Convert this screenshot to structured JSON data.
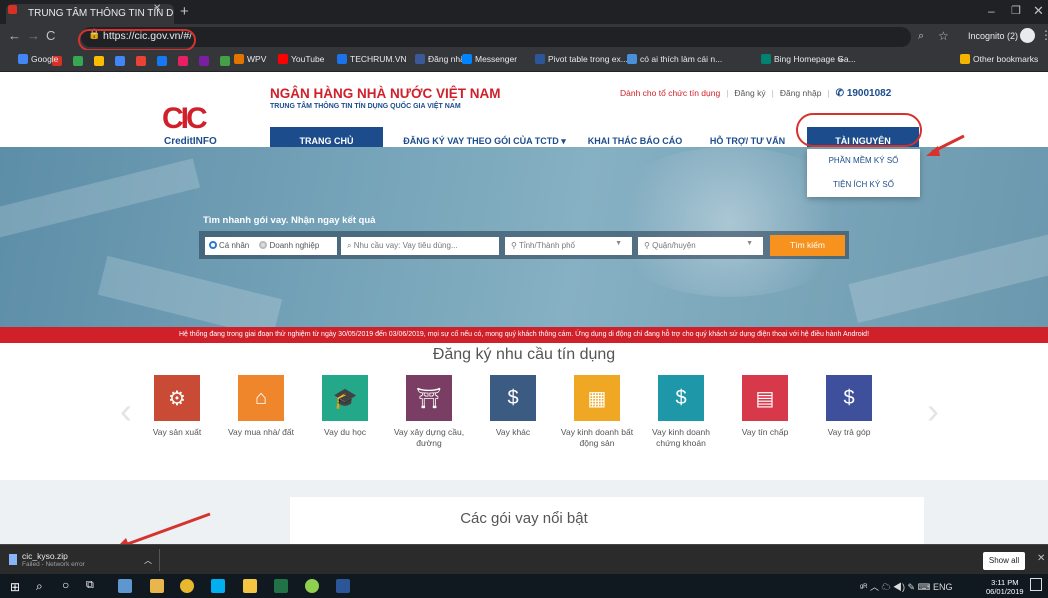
{
  "browser": {
    "tab_title": "TRUNG TÂM THÔNG TIN TÍN DỤ",
    "url": "https://cic.gov.vn/#/",
    "incognito_label": "Incognito (2)",
    "bookmarks": [
      {
        "label": "Google",
        "color": "#4285f4"
      },
      {
        "label": "WPV",
        "color": "#e37400"
      },
      {
        "label": "YouTube",
        "color": "#ff0000"
      },
      {
        "label": "TECHRUM.VN",
        "color": "#1a73e8"
      },
      {
        "label": "Đăng nhập",
        "color": "#3b5998"
      },
      {
        "label": "Messenger",
        "color": "#0084ff"
      },
      {
        "label": "Pivot table trong ex...",
        "color": "#2b579a"
      },
      {
        "label": "có ai thích làm cái n...",
        "color": "#4a90d9"
      },
      {
        "label": "Bing Homepage Ga...",
        "color": "#008373"
      }
    ],
    "other_bookmarks": "Other bookmarks"
  },
  "site": {
    "logo_text_1": "CIC",
    "logo_text_2": "CreditINFO",
    "title": "NGÂN HÀNG NHÀ NƯỚC VIỆT NAM",
    "subtitle": "TRUNG TÂM THÔNG TIN TÍN DỤNG QUỐC GIA VIỆT NAM",
    "top_links": {
      "org": "Dành cho tổ chức tín dụng",
      "register": "Đăng ký",
      "login": "Đăng nhập",
      "hotline": "19001082"
    },
    "nav": [
      "TRANG CHỦ",
      "ĐĂNG KÝ VAY THEO GÓI CỦA TCTD ▾",
      "KHAI THÁC BÁO CÁO",
      "HỖ TRỢ/ TƯ VẤN",
      "TÀI NGUYÊN"
    ],
    "dropdown": [
      "PHẦN MỀM KÝ SỐ",
      "TIỆN ÍCH KÝ SỐ"
    ],
    "search": {
      "title": "Tìm nhanh gói vay. Nhận ngay kết quả",
      "radio_individual": "Cá nhân",
      "radio_business": "Doanh nghiệp",
      "need_placeholder": "Nhu cầu vay: Vay tiêu dùng...",
      "province": "Tỉnh/Thành phố",
      "district": "Quận/huyện",
      "button": "Tìm kiếm"
    },
    "notice": "Hệ thống đang trong giai đoạn thử nghiệm từ ngày 30/05/2019 đến 03/06/2019, mọi sự cố nếu có, mong quý khách thông cảm. Ứng dụng di động chỉ đang hỗ trợ cho quý khách sử dụng điện thoại với hệ điều hành Android!",
    "services_title": "Đăng ký nhu cầu tín dụng",
    "services": [
      {
        "label": "Vay sản xuất",
        "color": "#c94a35",
        "icon": "⚙"
      },
      {
        "label": "Vay mua nhà/ đất",
        "color": "#f0862c",
        "icon": "⌂"
      },
      {
        "label": "Vay du học",
        "color": "#24a88a",
        "icon": "🎓"
      },
      {
        "label": "Vay xây dựng cầu, đường",
        "color": "#7a3d63",
        "icon": "⛩"
      },
      {
        "label": "Vay khác",
        "color": "#3c5b82",
        "icon": "$"
      },
      {
        "label": "Vay kinh doanh bất động sản",
        "color": "#f0a824",
        "icon": "▦"
      },
      {
        "label": "Vay kinh doanh chứng khoán",
        "color": "#1e98a8",
        "icon": "$"
      },
      {
        "label": "Vay tín chấp",
        "color": "#d8394a",
        "icon": "▤"
      },
      {
        "label": "Vay trả góp",
        "color": "#3e4f9c",
        "icon": "$"
      }
    ],
    "packages_title": "Các gói vay nổi bật"
  },
  "download": {
    "filename": "cic_kyso.zip",
    "status": "Failed - Network error",
    "show_all": "Show all"
  },
  "taskbar": {
    "lang": "ENG",
    "time": "3:11 PM",
    "date": "06/01/2019"
  }
}
